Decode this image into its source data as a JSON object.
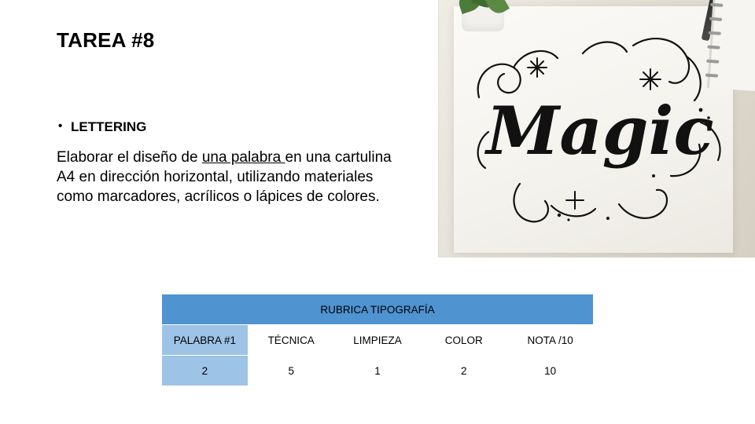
{
  "slide": {
    "title": "TAREA #8",
    "bullet": {
      "marker": "•",
      "label": "LETTERING"
    },
    "paragraph": {
      "before": "Elaborar el diseño de ",
      "underlined": "una palabra ",
      "after": "en una cartulina A4 en dirección horizontal, utilizando materiales como marcadores, acrílicos o lápices de colores."
    },
    "image": {
      "alt_name": "lettering-photo",
      "word": "Magic"
    },
    "table": {
      "header": "RUBRICA  TIPOGRAFÍA",
      "columns": [
        "PALABRA #1",
        "TÉCNICA",
        "LIMPIEZA",
        "COLOR",
        "NOTA /10"
      ],
      "row": [
        "2",
        "5",
        "1",
        "2",
        "10"
      ]
    },
    "colors": {
      "header_blue": "#4f93d1",
      "label_blue": "#9dc3e6",
      "text": "#000000",
      "background": "#ffffff"
    }
  }
}
